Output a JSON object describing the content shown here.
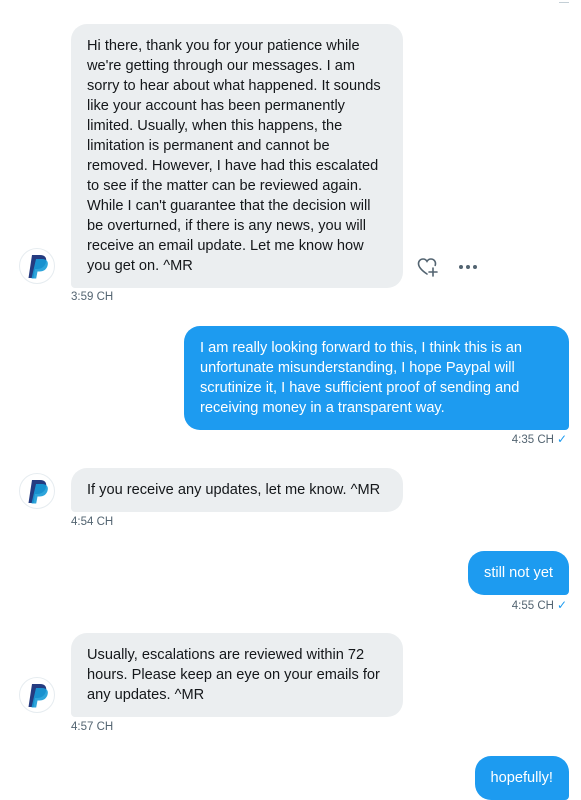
{
  "conversation": {
    "messages": [
      {
        "sender": "PayPal",
        "text": "Hi there, thank you for your patience while we're getting through our messages. I am sorry to hear about what happened. It sounds like your account has been permanently limited. Usually, when this happens, the limitation is permanent and cannot be removed. However, I have had this escalated to see if the matter can be reviewed again. While I can't guarantee that the decision will be overturned, if there is any news, you will receive an email update. Let me know how you get on. ^MR",
        "time": "3:59 CH"
      },
      {
        "sender": "me",
        "text": "I am really looking forward to this, I think this is an unfortunate misunderstanding, I hope Paypal will scrutinize it, I have sufficient proof of sending and receiving money in a transparent way.",
        "time": "4:35 CH"
      },
      {
        "sender": "PayPal",
        "text": "If you receive any updates, let me know. ^MR",
        "time": "4:54 CH"
      },
      {
        "sender": "me",
        "text": "still not yet",
        "time": "4:55 CH"
      },
      {
        "sender": "PayPal",
        "text": "Usually, escalations are reviewed within 72 hours. Please keep an eye on your emails for any updates. ^MR",
        "time": "4:57 CH"
      },
      {
        "sender": "me",
        "text": "hopefully!"
      }
    ]
  },
  "icons": {
    "avatar": "paypal-logo",
    "react": "heart-plus-icon",
    "more": "more-horizontal-icon",
    "seen": "checkmark-icon"
  },
  "colors": {
    "incoming_bubble": "#ebeef0",
    "outgoing_bubble": "#1d9bf0",
    "timestamp": "#536471",
    "accent": "#1d9bf0"
  }
}
